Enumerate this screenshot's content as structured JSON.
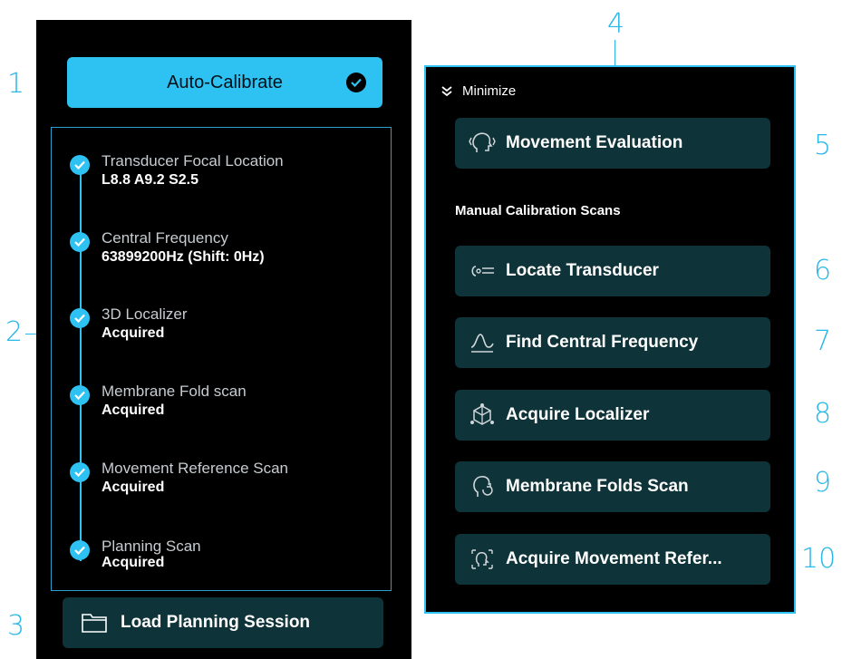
{
  "callouts": [
    "1",
    "2",
    "3",
    "4",
    "5",
    "6",
    "7",
    "8",
    "9",
    "10"
  ],
  "left": {
    "auto_calibrate": {
      "label": "Auto-Calibrate",
      "icon": "check-circle-icon"
    },
    "steps": [
      {
        "title": "Transducer Focal Location",
        "value": "L8.8 A9.2 S2.5"
      },
      {
        "title": "Central Frequency",
        "value": "63899200Hz (Shift: 0Hz)"
      },
      {
        "title": "3D Localizer",
        "value": "Acquired"
      },
      {
        "title": "Membrane Fold scan",
        "value": "Acquired"
      },
      {
        "title": "Movement Reference Scan",
        "value": "Acquired"
      },
      {
        "title": "Planning Scan",
        "value": "Acquired"
      }
    ],
    "load_session": {
      "label": "Load Planning Session",
      "icon": "folder-icon"
    }
  },
  "right": {
    "minimize_label": "Minimize",
    "movement_evaluation": "Movement Evaluation",
    "section_label": "Manual Calibration Scans",
    "buttons": [
      {
        "label": "Locate Transducer",
        "icon": "transducer-icon"
      },
      {
        "label": "Find Central Frequency",
        "icon": "frequency-curve-icon"
      },
      {
        "label": "Acquire Localizer",
        "icon": "cube-axes-icon"
      },
      {
        "label": "Membrane Folds Scan",
        "icon": "head-refresh-icon"
      },
      {
        "label": "Acquire Movement Refer...",
        "icon": "head-frame-icon"
      }
    ]
  },
  "colors": {
    "accent": "#2ec2f2",
    "button_bg": "#0e3338",
    "panel_bg": "#000000"
  }
}
